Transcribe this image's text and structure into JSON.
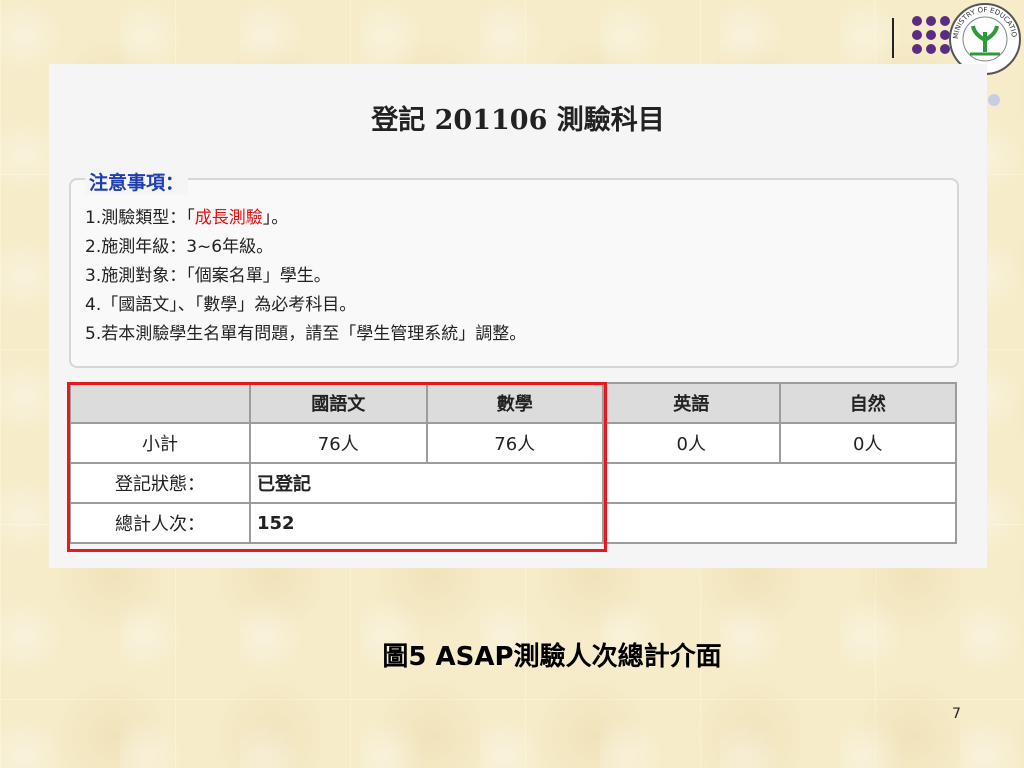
{
  "screenshot": {
    "title": "登記 201106 測驗科目",
    "notice": {
      "heading": "注意事項：",
      "items": [
        {
          "prefix": "1.測驗類型：「",
          "highlight": "成長測驗",
          "suffix": "」。"
        },
        {
          "text": "2.施測年級：3~6年級。"
        },
        {
          "text": "3.施測對象：「個案名單」學生。"
        },
        {
          "text": "4.「國語文」、「數學」為必考科目。"
        },
        {
          "text": "5.若本測驗學生名單有問題，請至「學生管理系統」調整。"
        }
      ]
    },
    "table": {
      "headers": [
        "",
        "國語文",
        "數學",
        "英語",
        "自然"
      ],
      "subtotal_label": "小計",
      "subtotal_values": [
        "76人",
        "76人",
        "0人",
        "0人"
      ],
      "status_label": "登記狀態：",
      "status_value": "已登記",
      "total_label": "總計人次：",
      "total_value": "152"
    }
  },
  "caption": "圖5  ASAP測驗人次總計介面",
  "page_number": "7",
  "logo": {
    "text": "MINISTRY OF EDUCATION",
    "icon": "ministry-of-education-seal"
  },
  "colors": {
    "highlight_box": "#e6191e",
    "bullet_dots": "#5a2d82",
    "status_green": "#1b8a1b",
    "total_red": "#e01010",
    "notice_heading": "#1f3fb0"
  }
}
